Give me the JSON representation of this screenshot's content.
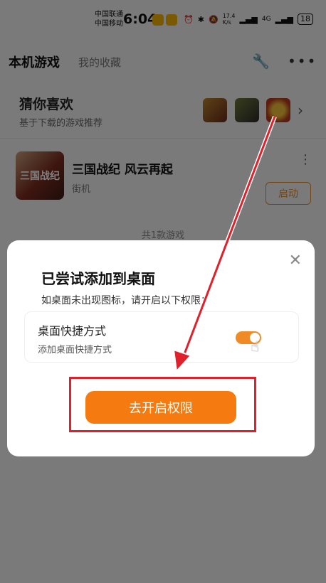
{
  "status": {
    "carrier1": "中国联通",
    "carrier2": "中国移动",
    "time": "6:04",
    "speed": "17.4\nK/s",
    "net": "4G",
    "battery": "18"
  },
  "nav": {
    "tab_active": "本机游戏",
    "tab2": "我的收藏",
    "tool_icon": "wrench-icon",
    "more_icon": "more-icon"
  },
  "guess": {
    "title": "猜你喜欢",
    "subtitle": "基于下载的游戏推荐"
  },
  "game": {
    "title": "三国战纪 风云再起",
    "genre": "街机",
    "launch": "启动",
    "icon_text": "三国战纪"
  },
  "count": "共1款游戏",
  "dialog": {
    "title": "已尝试添加到桌面",
    "desc": "如桌面未出现图标，请开启以下权限：",
    "perm_title": "桌面快捷方式",
    "perm_sub": "添加桌面快捷方式",
    "button": "去开启权限",
    "toggle_on": true
  },
  "colors": {
    "accent": "#f57a0f",
    "annotation": "#e0202a"
  }
}
